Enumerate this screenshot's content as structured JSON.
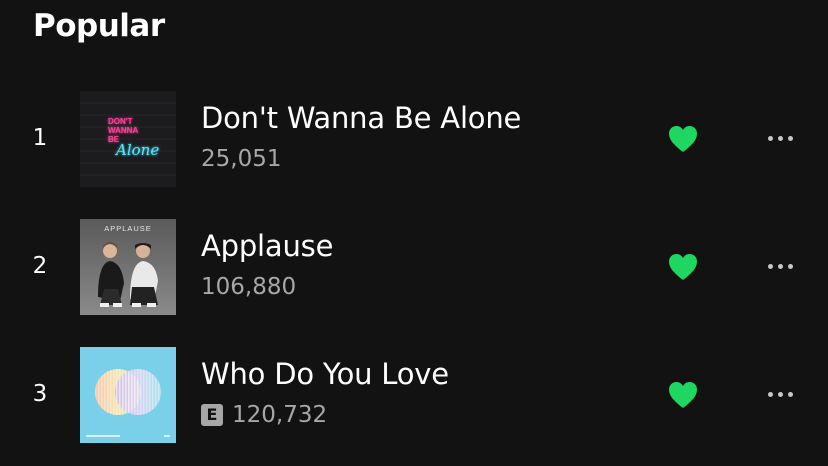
{
  "section": {
    "title": "Popular"
  },
  "colors": {
    "background": "#121212",
    "accent_like": "#1ed760",
    "text_primary": "#ffffff",
    "text_secondary": "#a7a7a7"
  },
  "tracks": [
    {
      "number": "1",
      "title": "Don't Wanna Be Alone",
      "plays": "25,051",
      "explicit": false,
      "liked": true,
      "cover_art": {
        "style": "neon-sign",
        "text_lines": [
          "DON'T",
          "WANNA",
          "BE",
          "Alone"
        ]
      }
    },
    {
      "number": "2",
      "title": "Applause",
      "plays": "106,880",
      "explicit": false,
      "liked": true,
      "cover_art": {
        "style": "photo-duo",
        "text_lines": [
          "APPLAUSE"
        ]
      }
    },
    {
      "number": "3",
      "title": "Who Do You Love",
      "plays": "120,732",
      "explicit": true,
      "explicit_label": "E",
      "liked": true,
      "cover_art": {
        "style": "pastel-circles",
        "text_lines": []
      }
    }
  ],
  "icons": {
    "like": "heart-icon",
    "more": "more-options-icon"
  }
}
